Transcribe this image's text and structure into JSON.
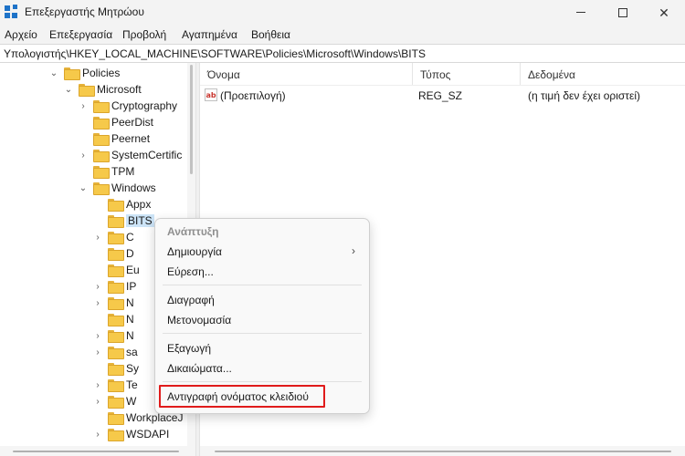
{
  "window": {
    "title": "Επεξεργαστής Μητρώου",
    "app_icon": "registry-editor-icon",
    "controls": [
      "minimize-icon",
      "maximize-icon",
      "close-icon"
    ]
  },
  "menu": [
    "Αρχείο",
    "Επεξεργασία",
    "Προβολή",
    "Αγαπημένα",
    "Βοήθεια"
  ],
  "address": "Υπολογιστής\\HKEY_LOCAL_MACHINE\\SOFTWARE\\Policies\\Microsoft\\Windows\\BITS",
  "tree": [
    {
      "label": "Policies",
      "expander": "⌄"
    },
    {
      "label": "Microsoft",
      "expander": "⌄"
    },
    {
      "label": "Cryptography",
      "expander": "›"
    },
    {
      "label": "PeerDist",
      "expander": ""
    },
    {
      "label": "Peernet",
      "expander": ""
    },
    {
      "label": "SystemCertific",
      "expander": "›"
    },
    {
      "label": "TPM",
      "expander": ""
    },
    {
      "label": "Windows",
      "expander": "⌄"
    },
    {
      "label": "Appx",
      "expander": ""
    },
    {
      "label": "BITS",
      "expander": ""
    },
    {
      "label": "C",
      "expander": "›"
    },
    {
      "label": "D",
      "expander": ""
    },
    {
      "label": "Eu",
      "expander": ""
    },
    {
      "label": "IP",
      "expander": "›"
    },
    {
      "label": "N",
      "expander": "›"
    },
    {
      "label": "N",
      "expander": ""
    },
    {
      "label": "N",
      "expander": "›"
    },
    {
      "label": "sa",
      "expander": "›"
    },
    {
      "label": "Sy",
      "expander": ""
    },
    {
      "label": "Te",
      "expander": "›"
    },
    {
      "label": "W",
      "expander": "›"
    },
    {
      "label": "WorkplaceJ",
      "expander": ""
    },
    {
      "label": "WSDAPI",
      "expander": "›"
    }
  ],
  "list": {
    "columns": [
      "Όνομα",
      "Τύπος",
      "Δεδομένα"
    ],
    "rows": [
      {
        "icon": "string-value-icon",
        "name": "(Προεπιλογή)",
        "type": "REG_SZ",
        "data": "(η τιμή δεν έχει οριστεί)"
      }
    ]
  },
  "context_menu": {
    "items": [
      {
        "label": "Ανάπτυξη",
        "disabled": true
      },
      {
        "label": "Δημιουργία",
        "submenu_arrow": "›"
      },
      {
        "label": "Εύρεση..."
      },
      {
        "label": "Διαγραφή"
      },
      {
        "label": "Μετονομασία"
      },
      {
        "label": "Εξαγωγή"
      },
      {
        "label": "Δικαιώματα..."
      },
      {
        "label": "Αντιγραφή ονόματος κλειδιού",
        "highlighted": true
      }
    ]
  },
  "colors": {
    "highlight_frame": "#e01b1b",
    "folder": "#f6c94a",
    "selection": "#cce4f7"
  }
}
